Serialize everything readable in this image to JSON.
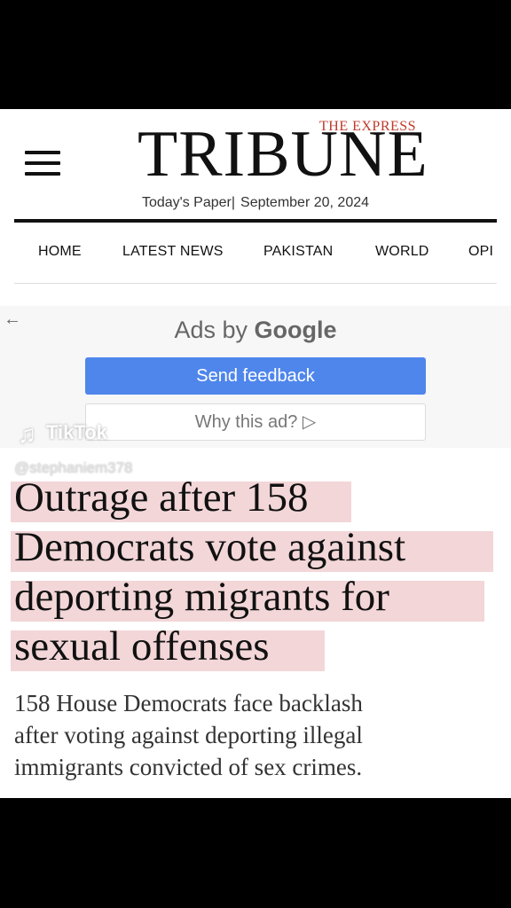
{
  "brand": {
    "top_line": "THE EXPRESS",
    "name": "TRIBUNE"
  },
  "dateline": {
    "todays_paper": "Today's Paper|",
    "date": "September 20, 2024"
  },
  "nav": {
    "items": [
      "HOME",
      "LATEST NEWS",
      "PAKISTAN",
      "WORLD",
      "OPI"
    ]
  },
  "ad": {
    "title_prefix": "Ads by",
    "title_brand": "Google",
    "send_feedback": "Send feedback",
    "why_this_ad": "Why this ad? ▷"
  },
  "overlay": {
    "app": "TikTok",
    "username": "@stephaniem378"
  },
  "article": {
    "headline_lines": [
      "Outrage after 158",
      "Democrats vote against",
      "deporting migrants for",
      "sexual offenses"
    ],
    "subheadline_lines": [
      "158 House Democrats face backlash",
      "after voting against deporting illegal",
      "immigrants convicted of sex crimes."
    ]
  },
  "colors": {
    "highlight": "#f3d6d8",
    "ad_button": "#4f86ec",
    "brand_accent": "#c0392b"
  }
}
